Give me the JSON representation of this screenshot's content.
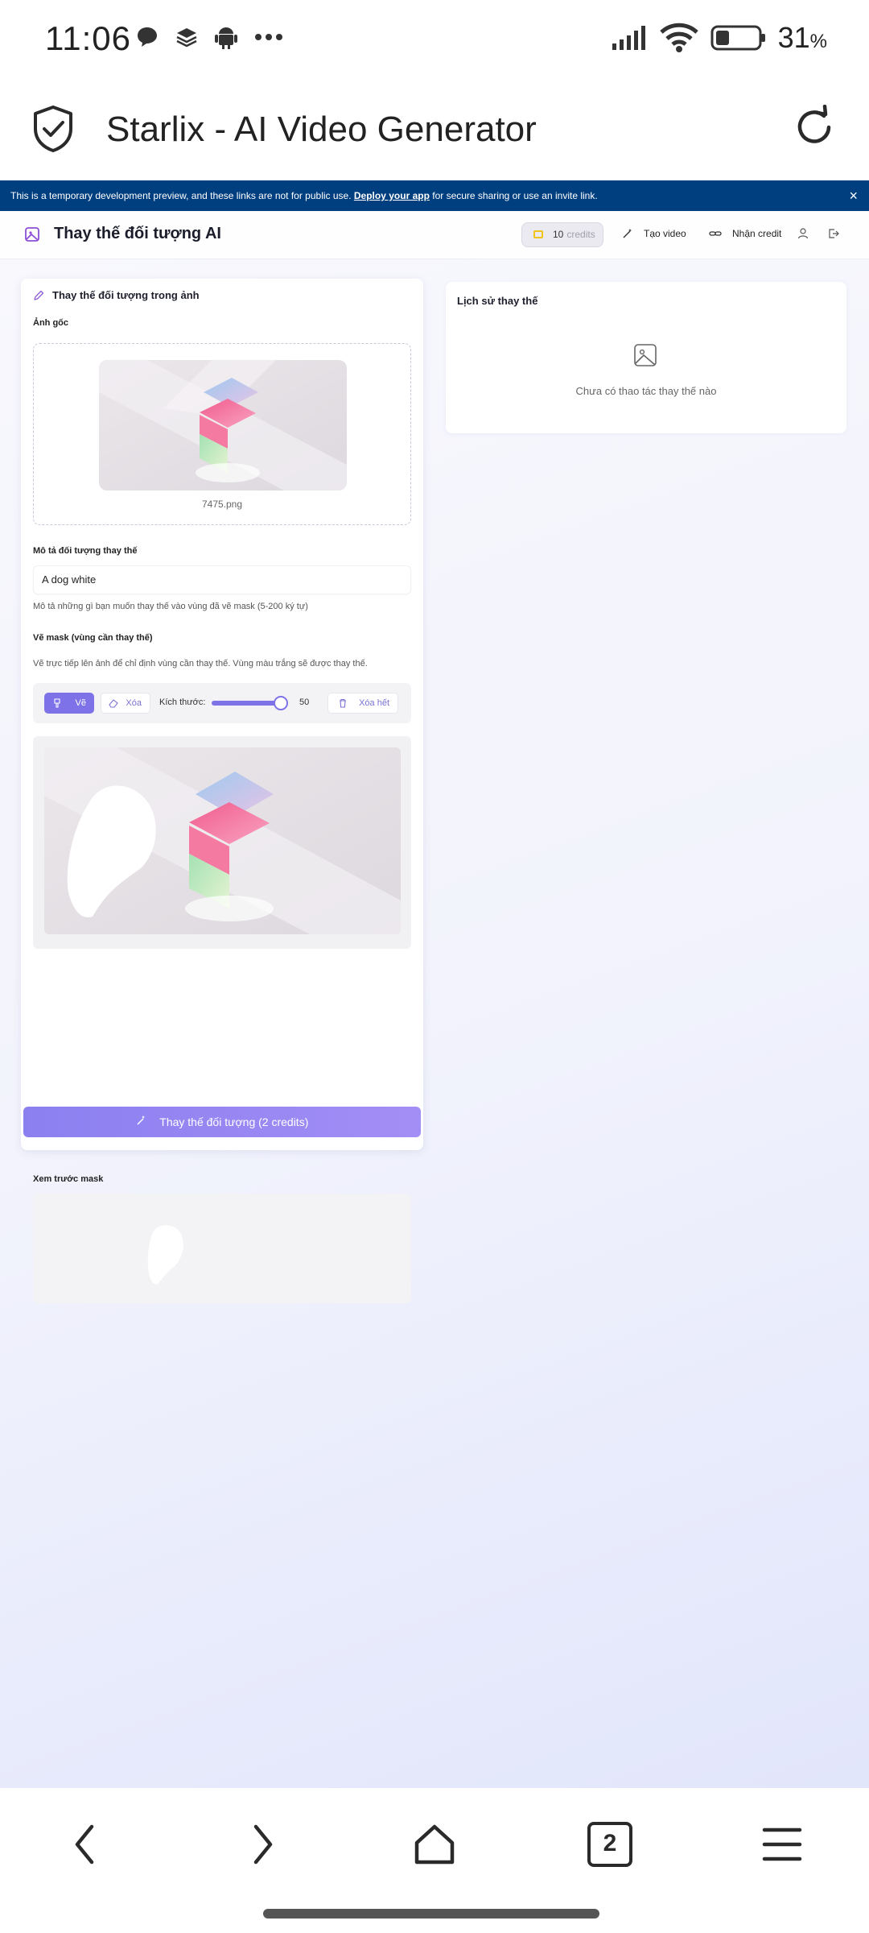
{
  "status_bar": {
    "time": "11:06",
    "battery_percent": "31",
    "battery_unit": "%",
    "icons_left": [
      "chat-bubble-icon",
      "layers-icon",
      "android-icon",
      "more-dots-icon"
    ],
    "icons_right": [
      "signal-icon",
      "wifi-icon",
      "battery-icon"
    ]
  },
  "browser": {
    "title": "Starlix - AI Video Generator"
  },
  "banner": {
    "text_before": "This is a temporary development preview, and these links are not for public use. ",
    "link": "Deploy your app",
    "text_after": " for secure sharing or use an invite link.",
    "close": "×"
  },
  "app_header": {
    "title": "Thay thế đối tượng AI",
    "credits_value": "10",
    "credits_label": "credits",
    "nav_create_video": "Tạo video",
    "nav_get_credit": "Nhận credit"
  },
  "editor": {
    "heading": "Thay thế đối tượng trong ảnh",
    "original_label": "Ảnh gốc",
    "filename": "7475.png",
    "description_label": "Mô tả đối tượng thay thế",
    "description_value": "A dog white",
    "description_help": "Mô tả những gì bạn muốn thay thế vào vùng đã vẽ mask (5-200 ký tự)",
    "mask_label": "Vẽ mask (vùng cần thay thế)",
    "mask_help": "Vẽ trực tiếp lên ảnh để chỉ định vùng cần thay thế. Vùng màu trắng sẽ được thay thế.",
    "tool_draw": "Vẽ",
    "tool_erase": "Xóa",
    "size_label": "Kích thước:",
    "brush_size": "50",
    "brush_size_fraction": 1.0,
    "clear_all": "Xóa hết",
    "mask_preview_label": "Xem trước mask",
    "submit": "Thay thế đối tượng (2 credits)"
  },
  "history": {
    "title": "Lịch sử thay thế",
    "empty": "Chưa có thao tác thay thế nào"
  },
  "bottom_nav": {
    "tab_count": "2"
  },
  "colors": {
    "accent": "#7d72e8",
    "banner": "#003f7f",
    "coin": "#f0c419"
  }
}
